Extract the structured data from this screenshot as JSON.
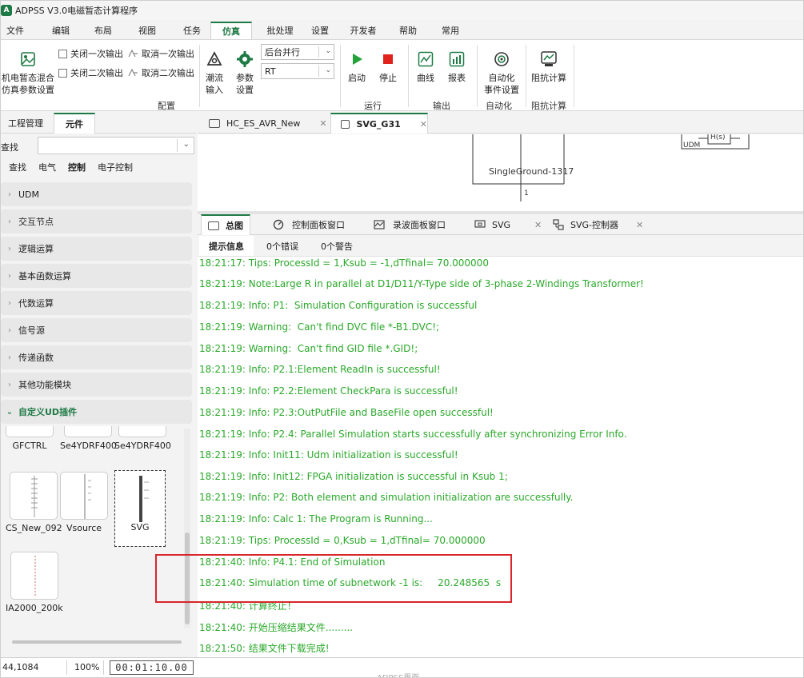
{
  "app": {
    "title": "ADPSS V3.0电磁暂态计算程序",
    "logo_letter": "A"
  },
  "menu": [
    "文件",
    "编辑",
    "布局",
    "视图",
    "任务",
    "仿真",
    "批处理",
    "设置",
    "开发者",
    "帮助",
    "常用"
  ],
  "menu_active_index": 5,
  "ribbon": {
    "mixed_sim": [
      "机电暂态混合",
      "仿真参数设置"
    ],
    "close_primary": "关闭一次输出",
    "cancel_primary": "取消一次输出",
    "close_secondary": "关闭二次输出",
    "cancel_secondary": "取消二次输出",
    "flow_input": [
      "潮流",
      "输入"
    ],
    "params": [
      "参数",
      "设置"
    ],
    "mode_combo": "后台并行",
    "rt_combo": "RT",
    "group_config": "配置",
    "start": "启动",
    "stop": "停止",
    "group_run": "运行",
    "curve": "曲线",
    "report": "报表",
    "group_output": "输出",
    "auto_event": [
      "自动化",
      "事件设置"
    ],
    "group_auto": "自动化",
    "impedance": "阻抗计算",
    "group_impedance": "阻抗计算"
  },
  "left_panel": {
    "tabs": [
      "工程管理",
      "元件"
    ],
    "find_label": "查找",
    "find_value": "",
    "sub_tabs": [
      "查找",
      "电气",
      "控制",
      "电子控制"
    ],
    "categories": [
      "UDM",
      "交互节点",
      "逻辑运算",
      "基本函数运算",
      "代数运算",
      "信号源",
      "传递函数",
      "其他功能模块",
      "自定义UD插件"
    ],
    "components": [
      "GFCTRL",
      "Se4YDRF400",
      "Se4YDRF400",
      "CS_New_092",
      "Vsource",
      "SVG",
      "IA2000_200k"
    ]
  },
  "doc_tabs": [
    "HC_ES_AVR_New",
    "SVG_G31"
  ],
  "canvas": {
    "label": "SingleGround-1317",
    "node": "1",
    "udm": "UDM",
    "block": "H(s)"
  },
  "output_tabs": [
    "总图",
    "控制面板窗口",
    "录波面板窗口",
    "SVG",
    "SVG-控制器"
  ],
  "output_sub_tabs": [
    "提示信息",
    "0个错误",
    "0个警告"
  ],
  "log_lines": [
    "18:21:17: Tips: ProcessId = 1,Ksub = -1,dTfinal= 70.000000",
    "18:21:19: Note:Large R in parallel at D1/D11/Y-Type side of 3-phase 2-Windings Transformer!",
    "18:21:19: Info: P1:  Simulation Configuration is successful",
    "18:21:19: Warning:  Can't find DVC file *-B1.DVC!;",
    "18:21:19: Warning:  Can't find GID file *.GID!;",
    "18:21:19: Info: P2.1:Element ReadIn is successful!",
    "18:21:19: Info: P2.2:Element CheckPara is successful!",
    "18:21:19: Info: P2.3:OutPutFile and BaseFile open successful!",
    "18:21:19: Info: P2.4: Parallel Simulation starts successfully after synchronizing Error Info.",
    "18:21:19: Info: Init11: Udm initialization is successful!",
    "18:21:19: Info: Init12: FPGA initialization is successful in Ksub 1;",
    "18:21:19: Info: P2: Both element and simulation initialization are successfully.",
    "18:21:19: Info: Calc 1: The Program is Running...",
    "18:21:19: Tips: ProcessId = 0,Ksub = 1,dTfinal= 70.000000",
    "18:21:40: Info: P4.1: End of Simulation",
    "18:21:40: Simulation time of subnetwork -1 is:     20.248565  s",
    "18:21:40: 计算终止！",
    "18:21:40: 开始压缩结果文件.........",
    "18:21:50: 结果文件下载完成!"
  ],
  "status": {
    "coords": "44,1084",
    "zoom": "100%",
    "clock": "00:01:10.00"
  },
  "bottom_caption": "ADPSS界面",
  "colors": {
    "accent": "#1e7a45",
    "log_text": "#2aa82a",
    "highlight": "#d8262b"
  }
}
